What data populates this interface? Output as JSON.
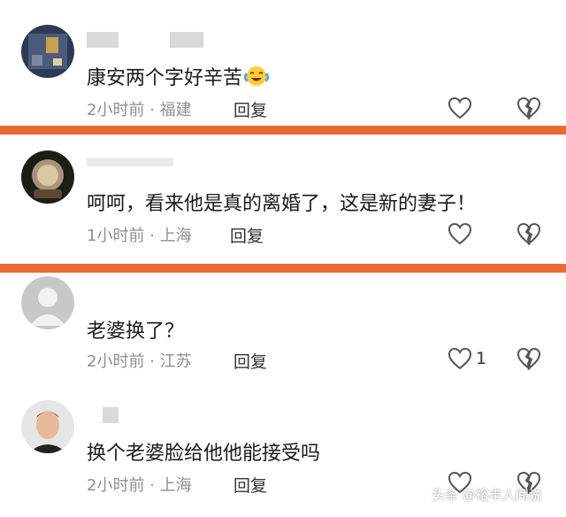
{
  "accent_divider_color": "#ef6a33",
  "comments": [
    {
      "text": "康安两个字好辛苦",
      "emoji": "laughing-crying-emoji",
      "time": "2小时前",
      "location": "福建",
      "reply_label": "回复",
      "like_count": ""
    },
    {
      "text": "呵呵，看来他是真的离婚了，这是新的妻子！",
      "time": "1小时前",
      "location": "上海",
      "reply_label": "回复",
      "like_count": ""
    },
    {
      "text": "老婆换了？",
      "time": "2小时前",
      "location": "江苏",
      "reply_label": "回复",
      "like_count": "1"
    },
    {
      "text": "换个老婆脸给他他能接受吗",
      "time": "2小时前",
      "location": "上海",
      "reply_label": "回复",
      "like_count": ""
    }
  ],
  "separator": " · ",
  "watermark": "头条 @裕丰人间说"
}
